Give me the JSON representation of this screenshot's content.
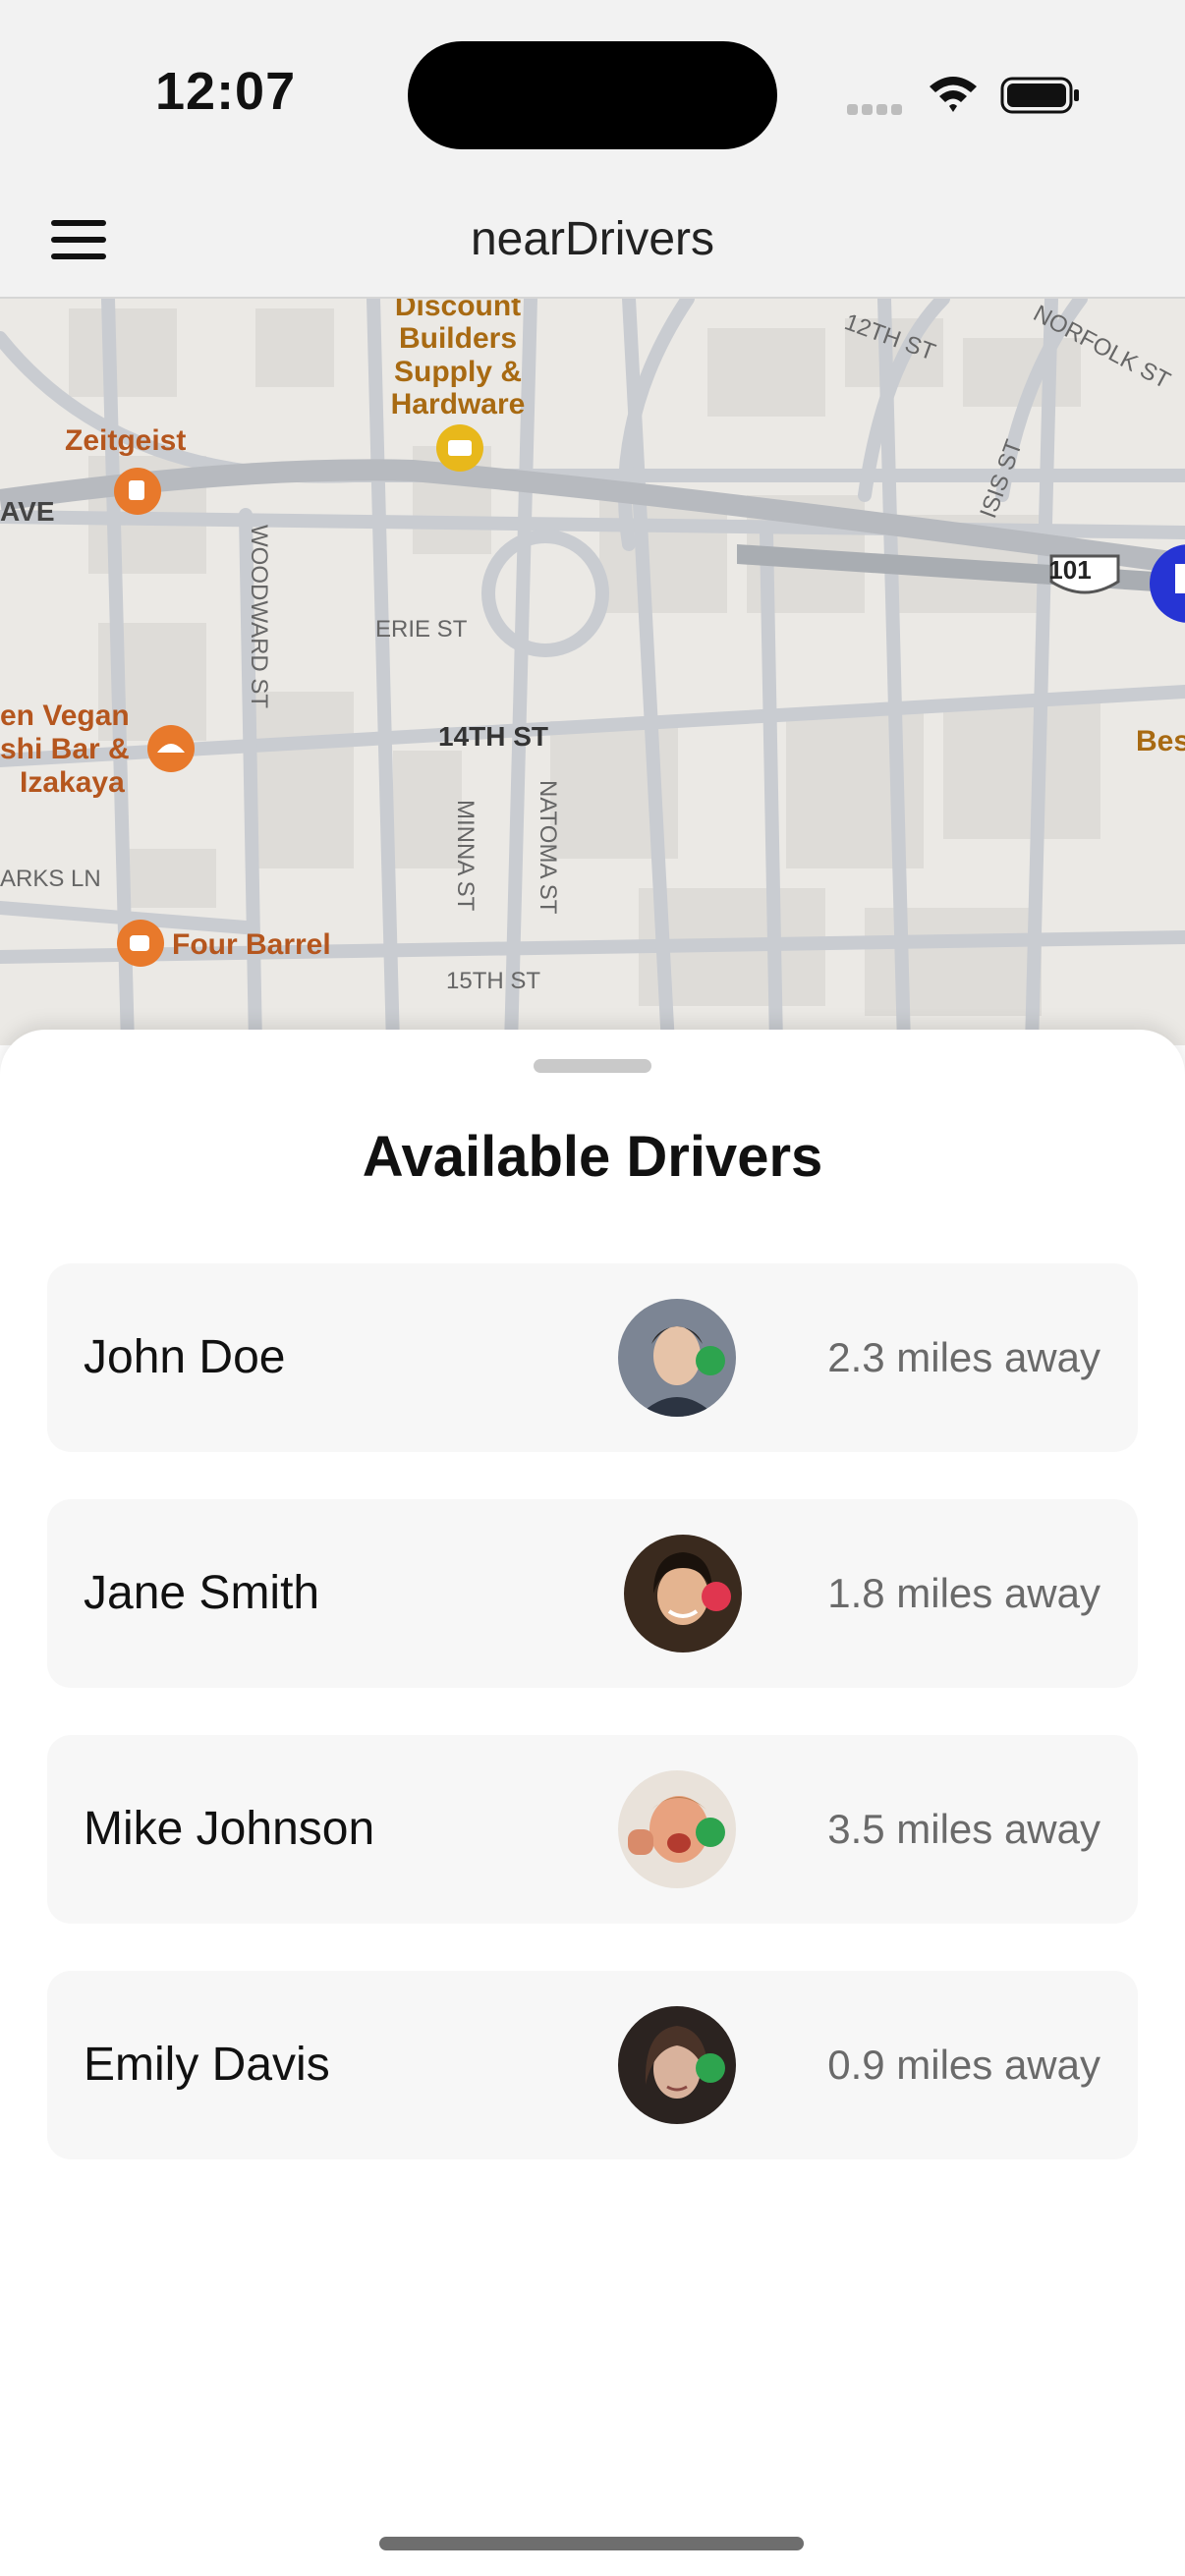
{
  "status_bar": {
    "time": "12:07"
  },
  "nav": {
    "title": "nearDrivers",
    "menu_icon": "hamburger-menu-icon"
  },
  "map": {
    "labels": {
      "discount_builders": [
        "Discount",
        "Builders",
        "Supply &",
        "Hardware"
      ],
      "zeitgeist": "Zeitgeist",
      "ave": "AVE",
      "woodward": "WOODWARD ST",
      "erie": "ERIE ST",
      "vegan": [
        "en Vegan",
        "shi Bar &",
        "Izakaya"
      ],
      "fourteenth": "14TH ST",
      "minna": "MINNA ST",
      "natoma": "NATOMA ST",
      "arks": "ARKS LN",
      "four_barrel": "Four Barrel",
      "fifteenth": "15TH ST",
      "twelfth": "12TH ST",
      "norfolk": "NORFOLK ST",
      "isis": "ISIS ST",
      "highway": "101",
      "bes": "Bes"
    }
  },
  "sheet": {
    "title": "Available Drivers",
    "drivers": [
      {
        "name": "John Doe",
        "distance": "2.3 miles away",
        "status_color": "#2da44e"
      },
      {
        "name": "Jane Smith",
        "distance": "1.8 miles away",
        "status_color": "#e0364f"
      },
      {
        "name": "Mike Johnson",
        "distance": "3.5 miles away",
        "status_color": "#2da44e"
      },
      {
        "name": "Emily Davis",
        "distance": "0.9 miles away",
        "status_color": "#2da44e"
      }
    ]
  },
  "colors": {
    "online": "#2da44e",
    "busy": "#e0364f",
    "poi_orange": "#e8792b",
    "poi_yellow": "#e8b81b"
  }
}
